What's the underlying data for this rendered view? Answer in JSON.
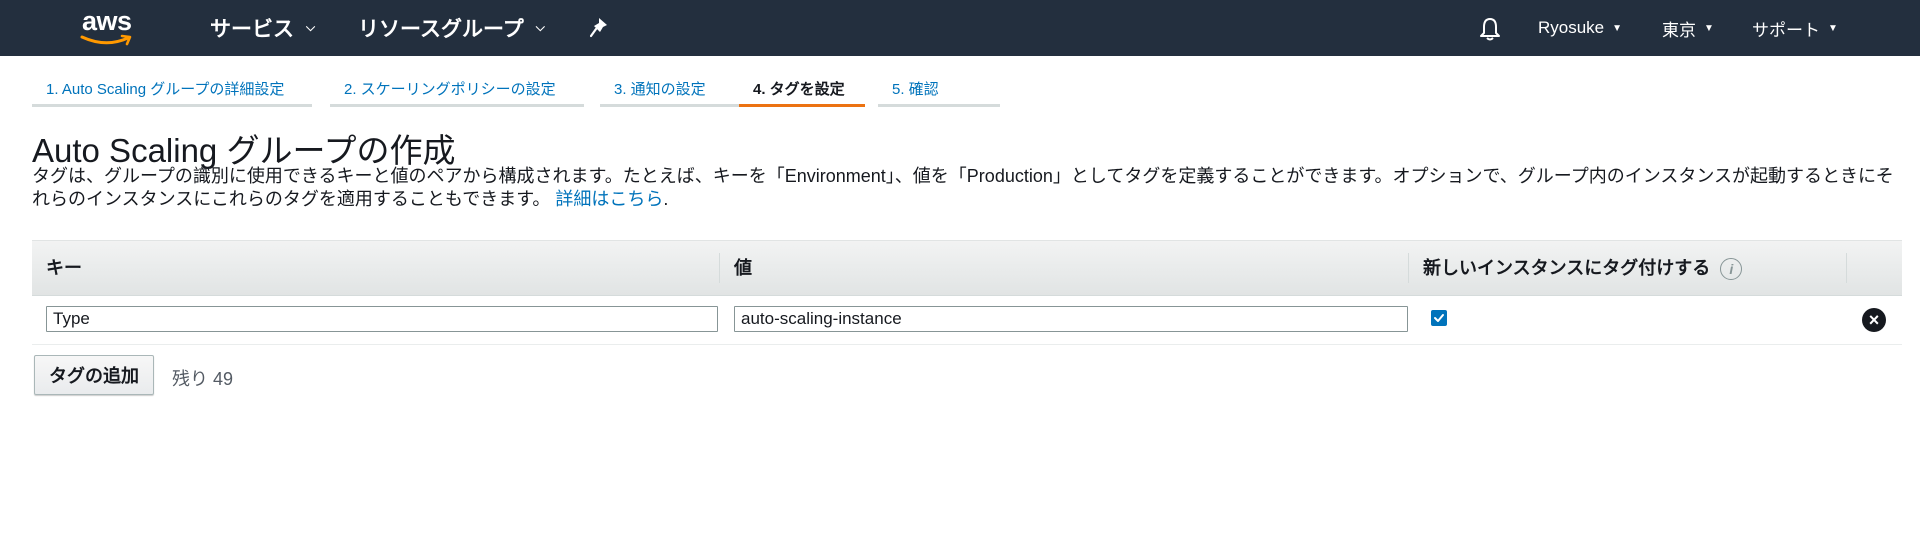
{
  "nav": {
    "logo_text": "aws",
    "services": "サービス",
    "resource_groups": "リソースグループ",
    "user": "Ryosuke",
    "region": "東京",
    "support": "サポート"
  },
  "steps": [
    {
      "label": "1. Auto Scaling グループの詳細設定",
      "active": false
    },
    {
      "label": "2. スケーリングポリシーの設定",
      "active": false
    },
    {
      "label": "3. 通知の設定",
      "active": false
    },
    {
      "label": "4. タグを設定",
      "active": true
    },
    {
      "label": "5. 確認",
      "active": false
    }
  ],
  "page": {
    "title": "Auto Scaling グループの作成",
    "description": "タグは、グループの識別に使用できるキーと値のペアから構成されます。たとえば、キーを「Environment」、値を「Production」としてタグを定義することができます。オプションで、グループ内のインスタンスが起動するときにそれらのインスタンスにこれらのタグを適用することもできます。",
    "learn_more": "詳細はこちら",
    "period": "."
  },
  "table": {
    "headers": {
      "key": "キー",
      "value": "値",
      "tag_new_instances": "新しいインスタンスにタグ付けする"
    },
    "rows": [
      {
        "key": "Type",
        "value": "auto-scaling-instance",
        "tag_new_instances": true
      }
    ]
  },
  "actions": {
    "add_tag": "タグの追加",
    "remaining": "残り 49"
  },
  "colors": {
    "nav_bg": "#232f3e",
    "link": "#0073bb",
    "active_step": "#ec7211"
  }
}
